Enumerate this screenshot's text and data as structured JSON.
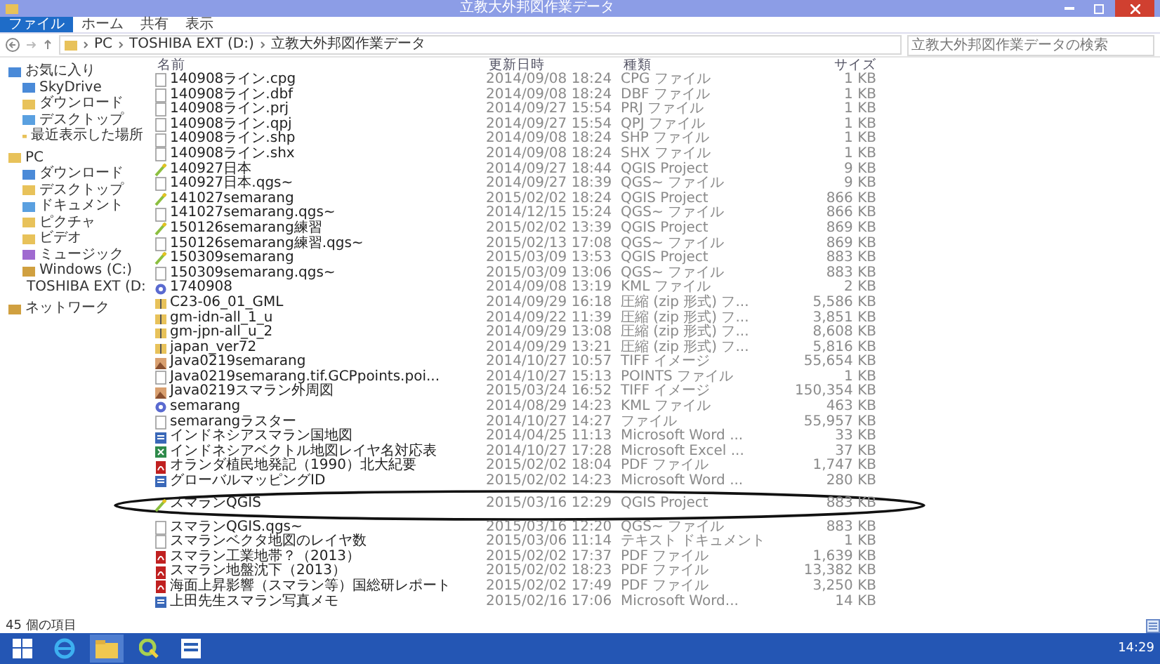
{
  "window": {
    "title": "立教大外邦図作業データ"
  },
  "ribbon": {
    "tabs": [
      {
        "label": "ファイル",
        "kind": "file"
      },
      {
        "label": "ホーム",
        "kind": "tab"
      },
      {
        "label": "共有",
        "kind": "tab"
      },
      {
        "label": "表示",
        "kind": "tab"
      }
    ]
  },
  "address": {
    "path": [
      "PC",
      "TOSHIBA EXT (D:)",
      "立教大外邦図作業データ"
    ],
    "search_placeholder": "立教大外邦図作業データの検索"
  },
  "sidebar": {
    "groups": [
      {
        "label": "お気に入り",
        "children": [
          {
            "label": "SkyDrive"
          },
          {
            "label": "ダウンロード"
          },
          {
            "label": "デスクトップ"
          },
          {
            "label": "最近表示した場所"
          }
        ]
      },
      {
        "label": "PC",
        "children": [
          {
            "label": "ダウンロード"
          },
          {
            "label": "デスクトップ"
          },
          {
            "label": "ドキュメント"
          },
          {
            "label": "ピクチャ"
          },
          {
            "label": "ビデオ"
          },
          {
            "label": "ミュージック"
          },
          {
            "label": "Windows (C:)"
          },
          {
            "label": "TOSHIBA EXT (D:"
          }
        ]
      },
      {
        "label": "ネットワーク"
      }
    ]
  },
  "table": {
    "columns": [
      "名前",
      "更新日時",
      "種類",
      "サイズ"
    ],
    "rows": [
      {
        "name": "140908ライン.cpg",
        "date": "2014/09/08 18:24",
        "type": "CPG ファイル",
        "size": "1 KB",
        "kind": "file",
        "circled": false
      },
      {
        "name": "140908ライン.dbf",
        "date": "2014/09/08 18:24",
        "type": "DBF ファイル",
        "size": "1 KB",
        "kind": "file",
        "circled": false
      },
      {
        "name": "140908ライン.prj",
        "date": "2014/09/27 15:54",
        "type": "PRJ ファイル",
        "size": "1 KB",
        "kind": "file",
        "circled": false
      },
      {
        "name": "140908ライン.qpj",
        "date": "2014/09/27 15:54",
        "type": "QPJ ファイル",
        "size": "1 KB",
        "kind": "file",
        "circled": false
      },
      {
        "name": "140908ライン.shp",
        "date": "2014/09/08 18:24",
        "type": "SHP ファイル",
        "size": "1 KB",
        "kind": "file",
        "circled": false
      },
      {
        "name": "140908ライン.shx",
        "date": "2014/09/08 18:24",
        "type": "SHX ファイル",
        "size": "1 KB",
        "kind": "file",
        "circled": false
      },
      {
        "name": "140927日本",
        "date": "2014/09/27 18:44",
        "type": "QGIS Project",
        "size": "9 KB",
        "kind": "qgis",
        "circled": false
      },
      {
        "name": "140927日本.qgs~",
        "date": "2014/09/27 18:39",
        "type": "QGS~ ファイル",
        "size": "9 KB",
        "kind": "file",
        "circled": false
      },
      {
        "name": "141027semarang",
        "date": "2015/02/02 18:24",
        "type": "QGIS Project",
        "size": "866 KB",
        "kind": "qgis",
        "circled": false
      },
      {
        "name": "141027semarang.qgs~",
        "date": "2014/12/15 15:24",
        "type": "QGS~ ファイル",
        "size": "866 KB",
        "kind": "file",
        "circled": false
      },
      {
        "name": "150126semarang練習",
        "date": "2015/02/02 13:39",
        "type": "QGIS Project",
        "size": "869 KB",
        "kind": "qgis",
        "circled": false
      },
      {
        "name": "150126semarang練習.qgs~",
        "date": "2015/02/13 17:08",
        "type": "QGS~ ファイル",
        "size": "869 KB",
        "kind": "file",
        "circled": false
      },
      {
        "name": "150309semarang",
        "date": "2015/03/09 13:53",
        "type": "QGIS Project",
        "size": "883 KB",
        "kind": "qgis",
        "circled": false
      },
      {
        "name": "150309semarang.qgs~",
        "date": "2015/03/09 13:06",
        "type": "QGS~ ファイル",
        "size": "883 KB",
        "kind": "file",
        "circled": false
      },
      {
        "name": "1740908",
        "date": "2014/09/08 13:19",
        "type": "KML ファイル",
        "size": "2 KB",
        "kind": "kml",
        "circled": false
      },
      {
        "name": "C23-06_01_GML",
        "date": "2014/09/29 16:18",
        "type": "圧縮 (zip 形式) フ...",
        "size": "5,586 KB",
        "kind": "zip",
        "circled": false
      },
      {
        "name": "gm-idn-all_1_u",
        "date": "2014/09/22 11:39",
        "type": "圧縮 (zip 形式) フ...",
        "size": "3,851 KB",
        "kind": "zip",
        "circled": false
      },
      {
        "name": "gm-jpn-all_u_2",
        "date": "2014/09/29 13:08",
        "type": "圧縮 (zip 形式) フ...",
        "size": "8,608 KB",
        "kind": "zip",
        "circled": false
      },
      {
        "name": "japan_ver72",
        "date": "2014/09/29 13:21",
        "type": "圧縮 (zip 形式) フ...",
        "size": "5,816 KB",
        "kind": "zip",
        "circled": false
      },
      {
        "name": "Java0219semarang",
        "date": "2014/10/27 10:57",
        "type": "TIFF イメージ",
        "size": "55,654 KB",
        "kind": "image",
        "circled": false
      },
      {
        "name": "Java0219semarang.tif.GCPpoints.poi...",
        "date": "2014/10/27 15:13",
        "type": "POINTS ファイル",
        "size": "1 KB",
        "kind": "file",
        "circled": false
      },
      {
        "name": "Java0219スマラン外周図",
        "date": "2015/03/24 16:52",
        "type": "TIFF イメージ",
        "size": "150,354 KB",
        "kind": "image",
        "circled": false
      },
      {
        "name": "semarang",
        "date": "2014/08/29 14:23",
        "type": "KML ファイル",
        "size": "463 KB",
        "kind": "kml",
        "circled": false
      },
      {
        "name": "semarangラスター",
        "date": "2014/10/27 14:27",
        "type": "ファイル",
        "size": "55,957 KB",
        "kind": "file",
        "circled": false
      },
      {
        "name": "インドネシアスマラン国地図",
        "date": "2014/04/25 11:13",
        "type": "Microsoft Word ...",
        "size": "33 KB",
        "kind": "word",
        "circled": false
      },
      {
        "name": "インドネシアベクトル地図レイヤ名対応表",
        "date": "2014/10/27 17:28",
        "type": "Microsoft Excel ...",
        "size": "37 KB",
        "kind": "excel",
        "circled": false
      },
      {
        "name": "オランダ植民地発記（1990）北大紀要",
        "date": "2015/02/02 18:04",
        "type": "PDF ファイル",
        "size": "1,747 KB",
        "kind": "pdf",
        "circled": false
      },
      {
        "name": "グローバルマッピングID",
        "date": "2015/02/02 14:23",
        "type": "Microsoft Word ...",
        "size": "280 KB",
        "kind": "word",
        "circled": false
      },
      {
        "name": "スマランQGIS",
        "date": "2015/03/16 12:29",
        "type": "QGIS Project",
        "size": "883 KB",
        "kind": "qgis",
        "circled": true
      },
      {
        "name": "スマランQGIS.qgs~",
        "date": "2015/03/16 12:20",
        "type": "QGS~ ファイル",
        "size": "883 KB",
        "kind": "file",
        "circled": false
      },
      {
        "name": "スマランベクタ地図のレイヤ数",
        "date": "2015/03/06 11:14",
        "type": "テキスト ドキュメント",
        "size": "1 KB",
        "kind": "file",
        "circled": false
      },
      {
        "name": "スマラン工業地帯？（2013）",
        "date": "2015/02/02 17:37",
        "type": "PDF ファイル",
        "size": "1,639 KB",
        "kind": "pdf",
        "circled": false
      },
      {
        "name": "スマラン地盤沈下（2013）",
        "date": "2015/02/02 18:23",
        "type": "PDF ファイル",
        "size": "13,382 KB",
        "kind": "pdf",
        "circled": false
      },
      {
        "name": "海面上昇影響（スマラン等）国総研レポート",
        "date": "2015/02/02 17:49",
        "type": "PDF ファイル",
        "size": "3,250 KB",
        "kind": "pdf",
        "circled": false
      },
      {
        "name": "上田先生スマラン写真メモ",
        "date": "2015/02/16 17:06",
        "type": "Microsoft Word...",
        "size": "14 KB",
        "kind": "word",
        "circled": false
      }
    ]
  },
  "status_bar": {
    "count": "45 個の項目"
  },
  "taskbar": {
    "apps": [
      {
        "kind": "browser"
      },
      {
        "kind": "folder"
      },
      {
        "kind": "qgis"
      },
      {
        "kind": "word"
      }
    ],
    "clock": "14:29"
  }
}
